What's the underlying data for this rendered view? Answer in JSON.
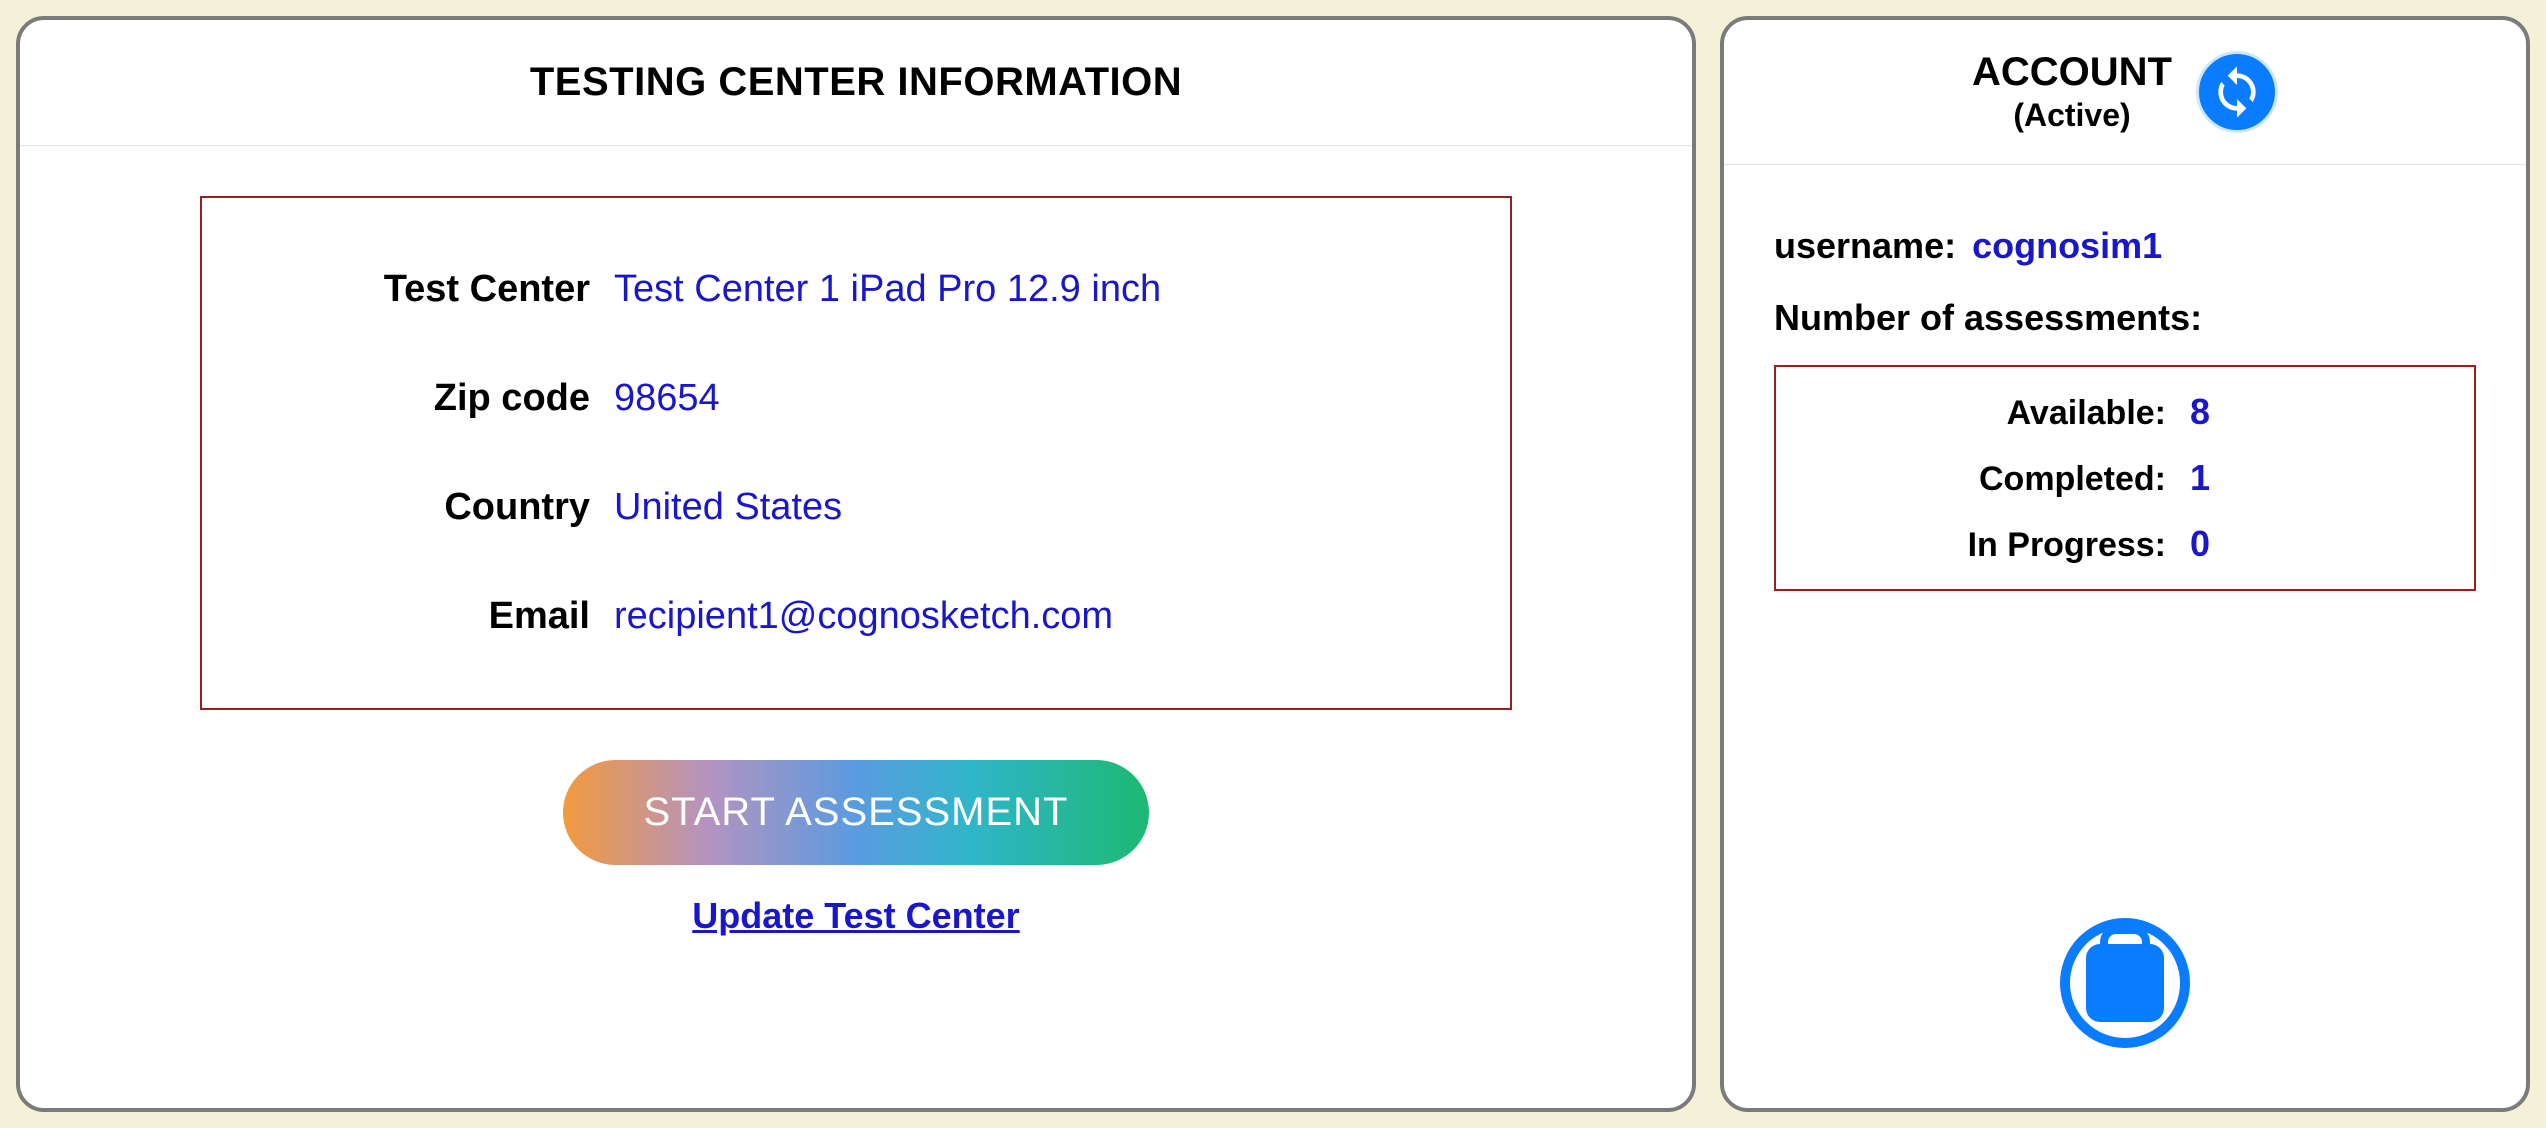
{
  "testing_center": {
    "title": "TESTING CENTER INFORMATION",
    "fields": {
      "test_center_label": "Test Center",
      "test_center_value": "Test Center 1 iPad Pro 12.9 inch",
      "zip_label": "Zip code",
      "zip_value": "98654",
      "country_label": "Country",
      "country_value": "United States",
      "email_label": "Email",
      "email_value": "recipient1@cognosketch.com"
    },
    "start_button": "START ASSESSMENT",
    "update_link": "Update Test Center"
  },
  "account": {
    "title": "ACCOUNT",
    "status": "(Active)",
    "username_label": "username:",
    "username_value": "cognosim1",
    "assessments_label": "Number of assessments:",
    "stats": {
      "available_label": "Available:",
      "available_value": "8",
      "completed_label": "Completed:",
      "completed_value": "1",
      "inprogress_label": "In Progress:",
      "inprogress_value": "0"
    }
  }
}
